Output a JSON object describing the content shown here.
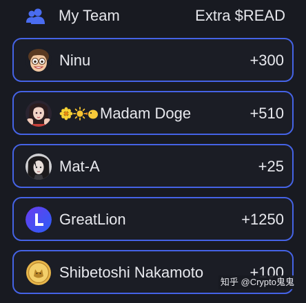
{
  "header": {
    "icon": "team-icon",
    "title": "My Team",
    "right_label": "Extra $READ"
  },
  "members": [
    {
      "name": "Ninu",
      "points": "+300",
      "avatar": "memoji-avatar"
    },
    {
      "name": "Madam Doge",
      "emoji_prefix": "🌼☀️🐤",
      "points": "+510",
      "avatar": "anime-girl-avatar"
    },
    {
      "name": "Mat-A",
      "points": "+25",
      "avatar": "dark-hair-avatar"
    },
    {
      "name": "GreatLion",
      "points": "+1250",
      "avatar": "purple-l-avatar"
    },
    {
      "name": "Shibetoshi Nakamoto",
      "points": "+100",
      "avatar": "gold-coin-avatar"
    }
  ],
  "watermark": "知乎 @Crypto鬼鬼",
  "colors": {
    "background": "#181a21",
    "card_border": "#4563e6",
    "header_icon": "#4a6cf0",
    "text": "#e8e9ee"
  }
}
